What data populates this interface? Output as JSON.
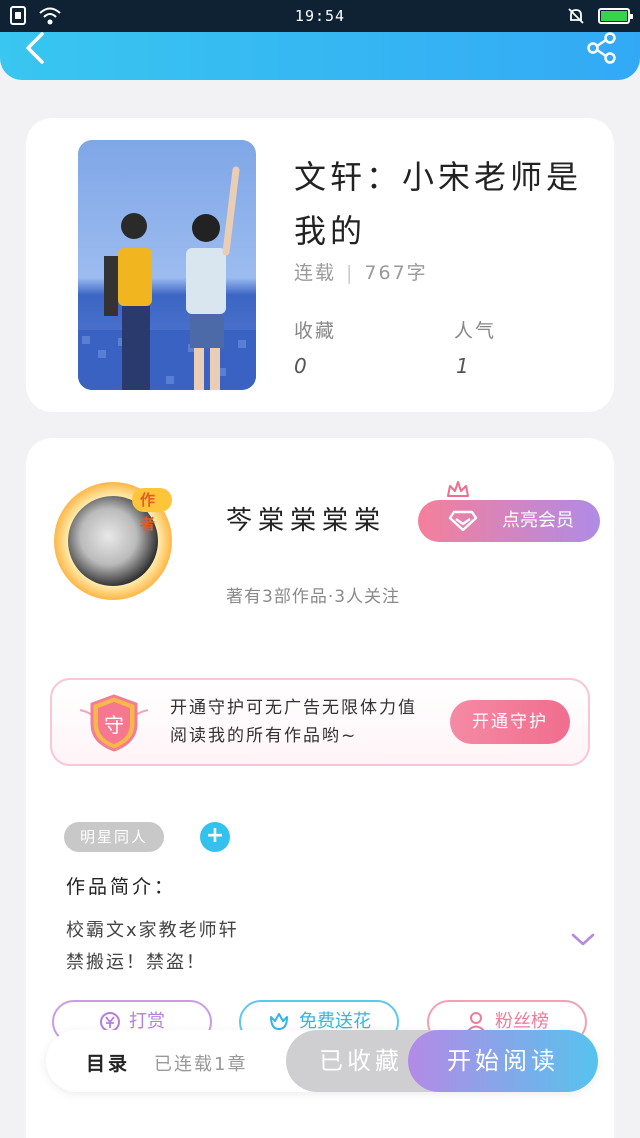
{
  "status_bar": {
    "time": "19:54"
  },
  "book": {
    "title": "文轩：小宋老师是我的",
    "status": "连载",
    "word_count": "767字",
    "favorites_label": "收藏",
    "favorites_value": "0",
    "popularity_label": "人气",
    "popularity_value": "1"
  },
  "author": {
    "badge": "作者",
    "name": "芩棠棠棠棠",
    "vip_label": "点亮会员",
    "info": "著有3部作品·3人关注"
  },
  "guard": {
    "icon_char": "守",
    "text": "开通守护可无广告无限体力值阅读我的所有作品哟~",
    "button": "开通守护"
  },
  "tags": [
    "明星同人"
  ],
  "intro": {
    "heading": "作品简介：",
    "lines": [
      "校霸文x家教老师轩",
      "禁搬运！禁盗！"
    ]
  },
  "actions": {
    "tip": "打赏",
    "flower": "免费送花",
    "fans": "粉丝榜"
  },
  "bottom_bar": {
    "toc": "目录",
    "serial": "已连载1章",
    "collected": "已收藏",
    "start_reading": "开始阅读"
  },
  "colors": {
    "header": "#39c6f0",
    "accent_pink": "#f06d8e",
    "accent_purple": "#b48ae6",
    "accent_blue": "#33c2ee"
  }
}
